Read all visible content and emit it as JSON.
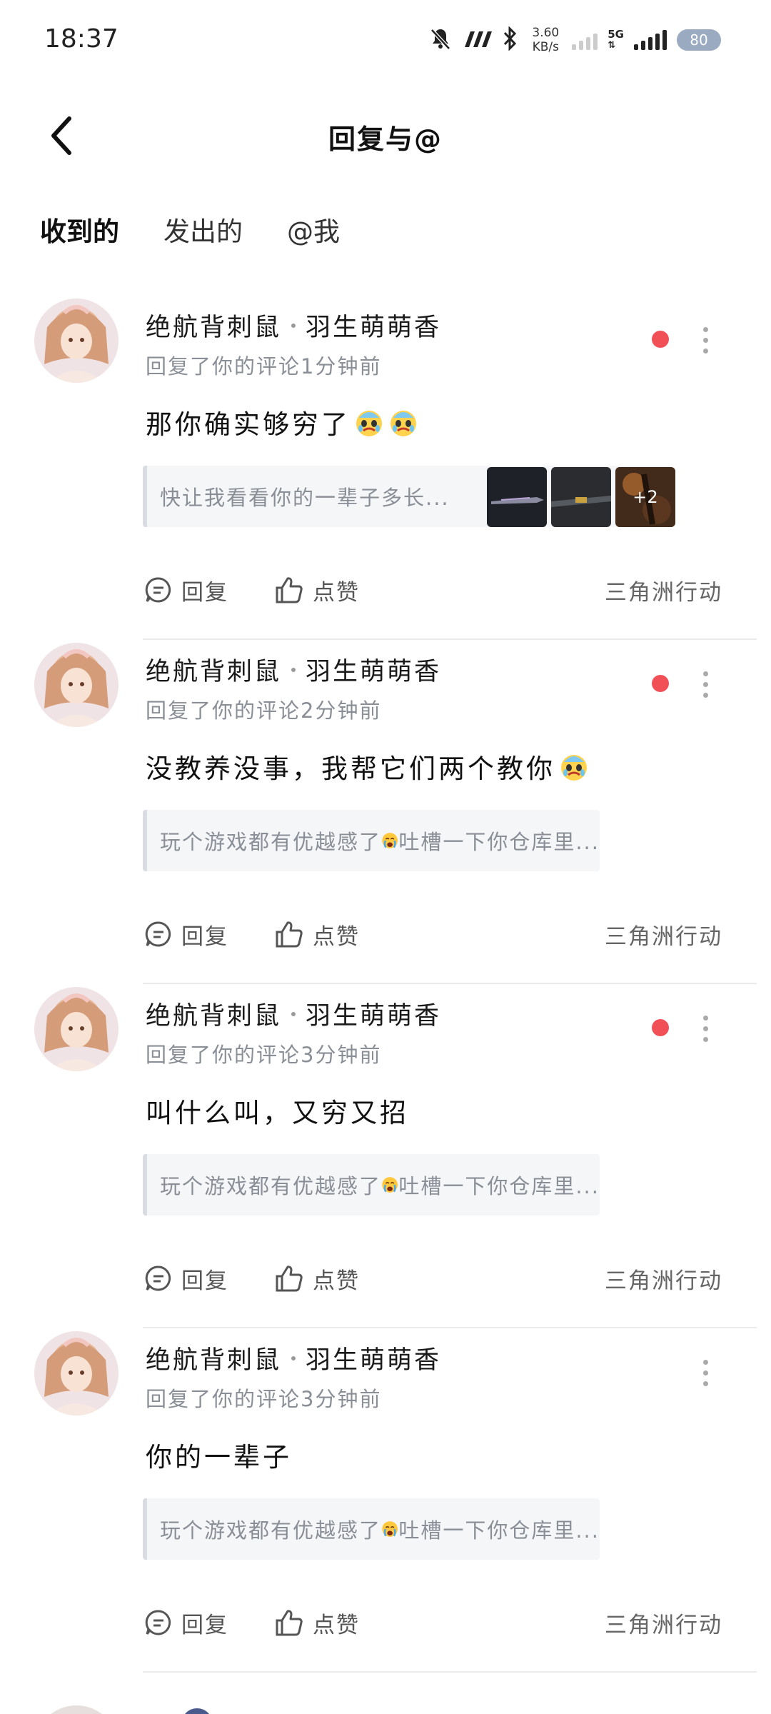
{
  "status": {
    "time": "18:37",
    "net_speed_value": "3.60",
    "net_speed_unit": "KB/s",
    "network_type": "5G",
    "battery": "80"
  },
  "header": {
    "title": "回复与@"
  },
  "tabs": [
    {
      "label": "收到的",
      "active": true
    },
    {
      "label": "发出的",
      "active": false
    },
    {
      "label": "@我",
      "active": false
    }
  ],
  "items": [
    {
      "author": "绝航背刺鼠",
      "author2": "羽生萌萌香",
      "subline": "回复了你的评论1分钟前",
      "content": "那你确实够穷了",
      "content_emojis": [
        "cry-smile-emoji",
        "cry-smile-emoji"
      ],
      "quote": "快让我看看你的一辈子多长...",
      "images_more": "+2",
      "unread": true,
      "reply_label": "回复",
      "like_label": "点赞",
      "game": "三角洲行动"
    },
    {
      "author": "绝航背刺鼠",
      "author2": "羽生萌萌香",
      "subline": "回复了你的评论2分钟前",
      "content": "没教养没事，我帮它们两个教你",
      "content_emojis": [
        "cry-smile-emoji"
      ],
      "quote_before": "玩个游戏都有优越感了",
      "quote_after": "吐槽一下你仓库里...",
      "unread": true,
      "reply_label": "回复",
      "like_label": "点赞",
      "game": "三角洲行动"
    },
    {
      "author": "绝航背刺鼠",
      "author2": "羽生萌萌香",
      "subline": "回复了你的评论3分钟前",
      "content": "叫什么叫，又穷又招",
      "quote_before": "玩个游戏都有优越感了",
      "quote_after": "吐槽一下你仓库里...",
      "unread": true,
      "reply_label": "回复",
      "like_label": "点赞",
      "game": "三角洲行动"
    },
    {
      "author": "绝航背刺鼠",
      "author2": "羽生萌萌香",
      "subline": "回复了你的评论3分钟前",
      "content": "你的一辈子",
      "quote_before": "玩个游戏都有优越感了",
      "quote_after": "吐槽一下你仓库里...",
      "unread": false,
      "reply_label": "回复",
      "like_label": "点赞",
      "game": "三角洲行动"
    }
  ],
  "colors": {
    "accent_underline": "#2fd1c4",
    "unread_dot": "#f25057",
    "muted_text": "#8a8e96"
  }
}
